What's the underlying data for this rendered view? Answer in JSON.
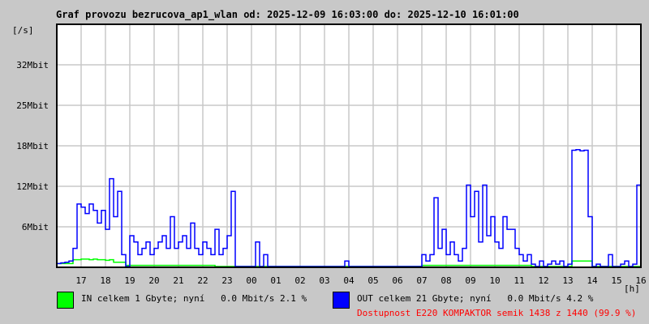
{
  "title": "Graf provozu bezrucova_ap1_wlan od: 2025-12-09 16:03:00 do: 2025-12-10 16:01:00",
  "unit_label": "[/s]",
  "hour_unit": "[h]",
  "colors": {
    "in": "#00ff00",
    "out": "#0000ff",
    "grid": "#c8c8c8",
    "availability": "#ff0000"
  },
  "legend": {
    "in": "IN celkem 1 Gbyte; nyní   0.0 Mbit/s 2.1 %",
    "out": "OUT celkem 21 Gbyte; nyní   0.0 Mbit/s 4.2 %",
    "availability": "Dostupnost E220 KOMPAKTOR semik 1438 z 1440 (99.9 %)"
  },
  "chart_data": {
    "type": "line",
    "title": "Graf provozu bezrucova_ap1_wlan od: 2025-12-09 16:03:00 do: 2025-12-10 16:01:00",
    "xlabel": "[h]",
    "ylabel": "[/s]",
    "x_unit": "hours since 2025-12-09 16:00",
    "xlim": [
      0,
      24
    ],
    "ylim": [
      0,
      38.4
    ],
    "grid": true,
    "x_ticks": [
      "17",
      "18",
      "19",
      "20",
      "21",
      "22",
      "23",
      "00",
      "01",
      "02",
      "03",
      "04",
      "05",
      "06",
      "07",
      "08",
      "09",
      "10",
      "11",
      "12",
      "13",
      "14",
      "15",
      "16"
    ],
    "y_ticks": [
      {
        "label": "6Mbit",
        "value": 6.4
      },
      {
        "label": "12Mbit",
        "value": 12.8
      },
      {
        "label": "18Mbit",
        "value": 19.2
      },
      {
        "label": "25Mbit",
        "value": 25.6
      },
      {
        "label": "32Mbit",
        "value": 32
      }
    ],
    "sample_step_hours": 0.1667,
    "series": [
      {
        "name": "IN",
        "unit": "Mbit/s",
        "values": [
          0.6,
          0.6,
          0.6,
          0.6,
          1.2,
          1.2,
          1.3,
          1.3,
          1.2,
          1.3,
          1.2,
          1.2,
          1.1,
          1.2,
          0.8,
          0.8,
          0.8,
          0.3,
          0.3,
          0.3,
          0.3,
          0.3,
          0.3,
          0.3,
          0.3,
          0.3,
          0.3,
          0.3,
          0.3,
          0.3,
          0.3,
          0.3,
          0.3,
          0.3,
          0.3,
          0.3,
          0.3,
          0.3,
          0.3,
          0,
          0,
          0,
          0,
          0,
          0,
          0,
          0,
          0,
          0,
          0,
          0,
          0,
          0,
          0,
          0,
          0,
          0,
          0,
          0,
          0,
          0,
          0,
          0,
          0,
          0,
          0,
          0,
          0,
          0,
          0,
          0,
          0,
          0,
          0,
          0,
          0,
          0,
          0,
          0,
          0,
          0,
          0,
          0,
          0,
          0,
          0,
          0,
          0,
          0,
          0,
          0.3,
          0.3,
          0.3,
          0.3,
          0.3,
          0.3,
          0.3,
          0.3,
          0.3,
          0.3,
          0.3,
          0.3,
          0.3,
          0.3,
          0.3,
          0.3,
          0.3,
          0.3,
          0.3,
          0.3,
          0.3,
          0.3,
          0.3,
          0.3,
          0.3,
          0.3,
          0.3,
          0,
          0,
          0,
          0,
          0,
          0,
          0,
          0,
          0,
          0,
          1.0,
          1.0,
          1.0,
          1.0,
          1.0,
          0,
          0,
          0,
          0,
          0,
          0,
          0,
          0,
          0,
          0,
          0,
          0,
          0
        ]
      },
      {
        "name": "OUT",
        "unit": "Mbit/s",
        "values": [
          0.6,
          0.7,
          0.8,
          1.0,
          3,
          10,
          9.5,
          8.5,
          10,
          9,
          7,
          9,
          6,
          14,
          8,
          12,
          2,
          0,
          5,
          4,
          2,
          3,
          4,
          2,
          3,
          4,
          5,
          3,
          8,
          3,
          4,
          5,
          3,
          7,
          3,
          2,
          4,
          3,
          2,
          6,
          2,
          3,
          5,
          12,
          0,
          0,
          0,
          0,
          0,
          4,
          0,
          2,
          0,
          0,
          0,
          0,
          0,
          0,
          0,
          0,
          0,
          0,
          0,
          0,
          0,
          0,
          0,
          0,
          0,
          0,
          0,
          1,
          0,
          0,
          0,
          0,
          0,
          0,
          0,
          0,
          0,
          0,
          0,
          0,
          0,
          0,
          0,
          0,
          0,
          0,
          2,
          1,
          2,
          11,
          3,
          6,
          2,
          4,
          2,
          1,
          3,
          13,
          8,
          12,
          4,
          13,
          5,
          8,
          4,
          3,
          8,
          6,
          6,
          3,
          2,
          1,
          2,
          0.5,
          0,
          1,
          0,
          0.5,
          1,
          0.5,
          1,
          0,
          0.5,
          18.5,
          18.6,
          18.4,
          18.5,
          8,
          0,
          0.5,
          0,
          0,
          2,
          0,
          0,
          0.5,
          1,
          0,
          0.5,
          13,
          0.5
        ]
      }
    ]
  }
}
